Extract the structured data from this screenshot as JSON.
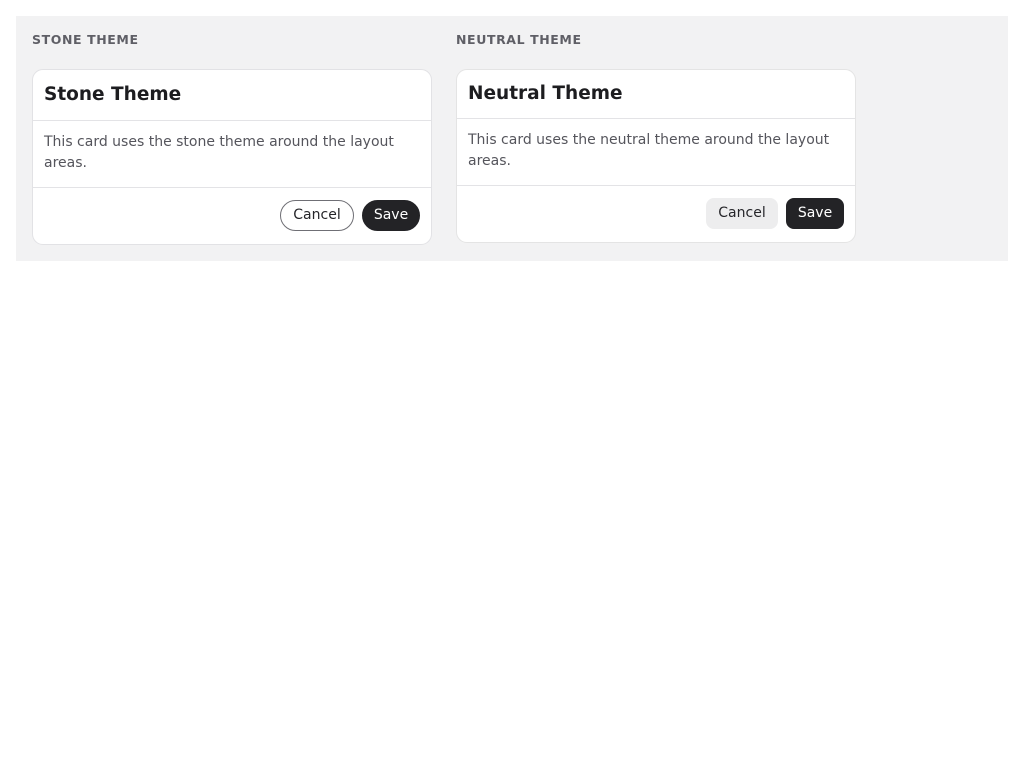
{
  "sections": [
    {
      "label": "STONE THEME",
      "card": {
        "title": "Stone Theme",
        "body": "This card uses the stone theme around the layout areas.",
        "cancel_label": "Cancel",
        "save_label": "Save"
      }
    },
    {
      "label": "NEUTRAL THEME",
      "card": {
        "title": "Neutral Theme",
        "body": "This card uses the neutral theme around the layout areas.",
        "cancel_label": "Cancel",
        "save_label": "Save"
      }
    }
  ],
  "colors": {
    "panel_background": "#f2f2f3",
    "card_background": "#ffffff",
    "primary_button": "#232326",
    "secondary_button_neutral": "#ededee",
    "label_text": "#5f5f66"
  }
}
